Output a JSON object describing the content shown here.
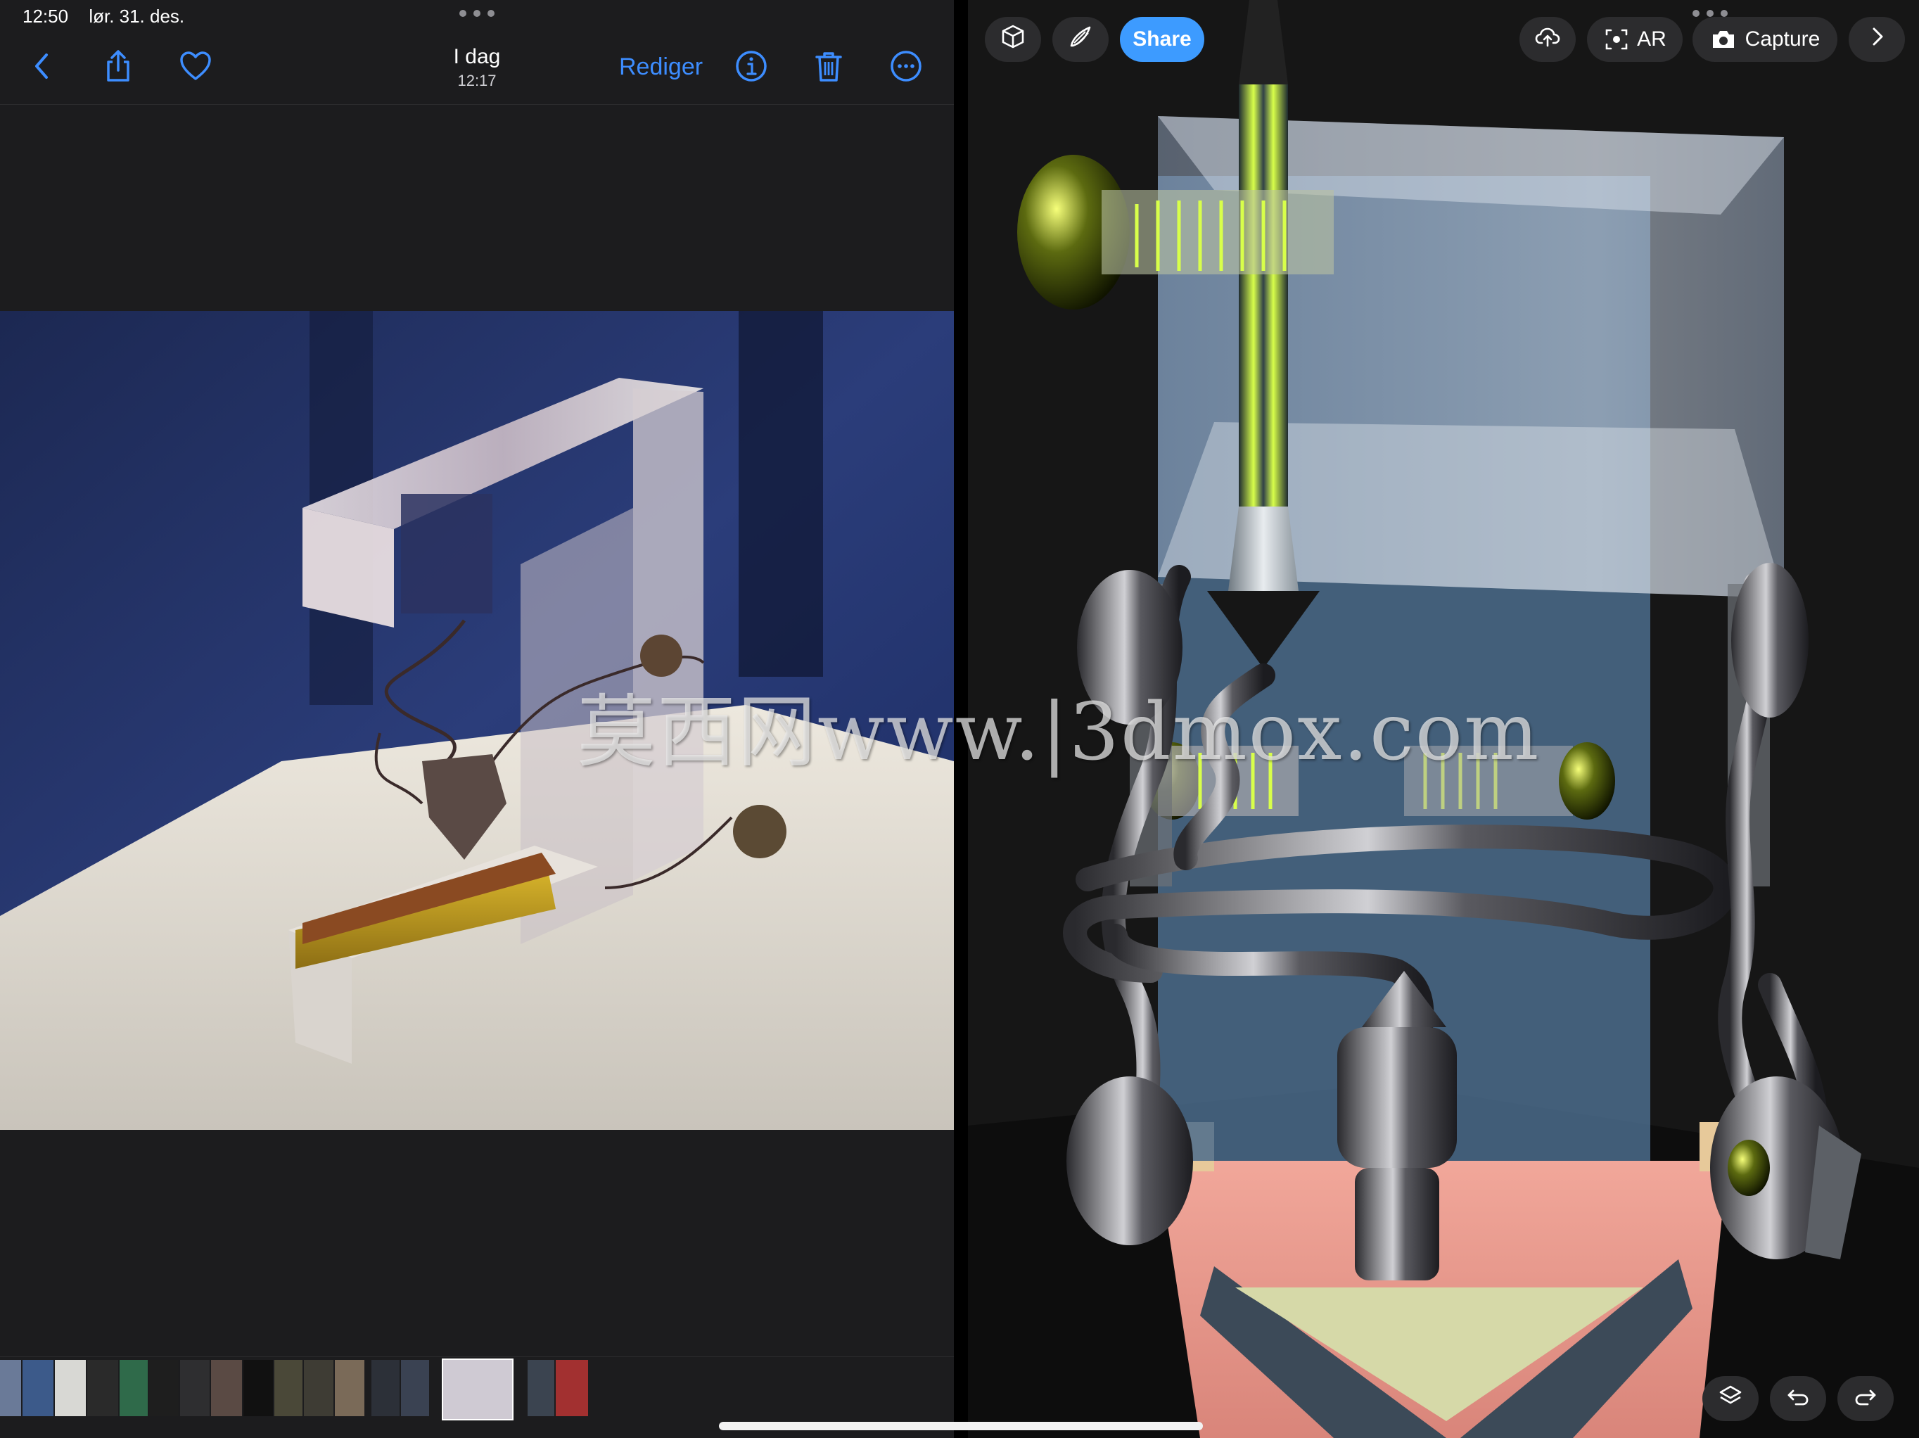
{
  "status": {
    "time": "12:50",
    "date": "lør. 31. des."
  },
  "photos": {
    "title": "I dag",
    "subtitle": "12:17",
    "edit_label": "Rediger",
    "icons": [
      "back-chevron-icon",
      "share-icon",
      "heart-icon",
      "info-icon",
      "trash-icon",
      "more-icon"
    ],
    "accent": "#3d8dff"
  },
  "viewer": {
    "share_label": "Share",
    "ar_label": "AR",
    "capture_label": "Capture",
    "accent": "#3d9bff"
  },
  "watermark": "莫西网www.|3dmox.com"
}
